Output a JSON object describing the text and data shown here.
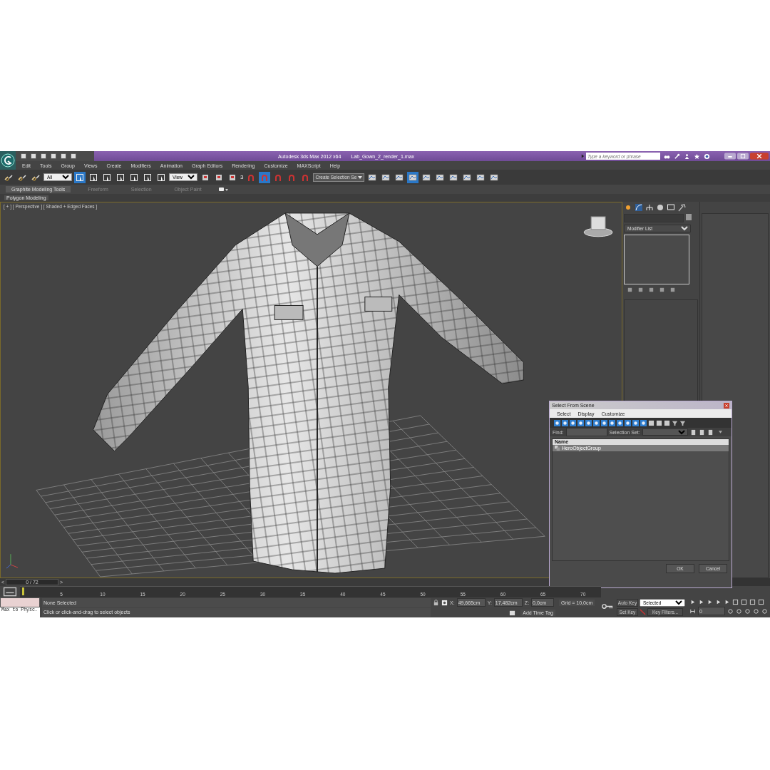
{
  "title_bar": {
    "app_title": "Autodesk 3ds Max 2012 x64",
    "file_name": "Lab_Gown_2_render_1.max",
    "search": {
      "placeholder": "Type a keyword or phrase"
    }
  },
  "menu": [
    "Edit",
    "Tools",
    "Group",
    "Views",
    "Create",
    "Modifiers",
    "Animation",
    "Graph Editors",
    "Rendering",
    "Customize",
    "MAXScript",
    "Help"
  ],
  "toolbar": {
    "selection_filter": "All",
    "reference_coord": "View",
    "snap_label": "3",
    "named_selection": "Create Selection Se"
  },
  "ribbon": {
    "tabs": [
      {
        "label": "Graphite Modeling Tools",
        "selected": true
      },
      {
        "label": "Freeform",
        "selected": false
      },
      {
        "label": "Selection",
        "selected": false
      },
      {
        "label": "Object Paint",
        "selected": false
      }
    ],
    "panel": "Polygon Modeling"
  },
  "viewport": {
    "label": "[ + ] [ Perspective ] [ Shaded + Edged Faces ]"
  },
  "command_panel": {
    "modifier_list": "Modifier List"
  },
  "dialog": {
    "title": "Select From Scene",
    "menu": [
      "Select",
      "Display",
      "Customize"
    ],
    "find_label": "Find:",
    "selection_set_label": "Selection Set:",
    "column": "Name",
    "rows": [
      {
        "name": "HeroObjectGroup",
        "selected": true
      }
    ],
    "buttons": [
      "OK",
      "Cancel"
    ]
  },
  "timeline": {
    "prev": "<",
    "frame": "0 / 72",
    "next": ">",
    "ticks": [
      "5",
      "10",
      "15",
      "20",
      "25",
      "30",
      "35",
      "40",
      "45",
      "50",
      "55",
      "60",
      "65",
      "70"
    ]
  },
  "status": {
    "listener": "Max to Physc.",
    "selection": "None Selected",
    "prompt": "Click or click-and-drag to select objects",
    "x_label": "X:",
    "x": "49,665cm",
    "y_label": "Y:",
    "y": "17,482cm",
    "z_label": "Z:",
    "z": "0,0cm",
    "grid": "Grid = 10,0cm",
    "time_tag": "Add Time Tag",
    "auto_key": "Auto Key",
    "key_mode": "Selected",
    "set_key": "Set Key",
    "key_filters": "Key Filters...",
    "current_frame": "0"
  }
}
